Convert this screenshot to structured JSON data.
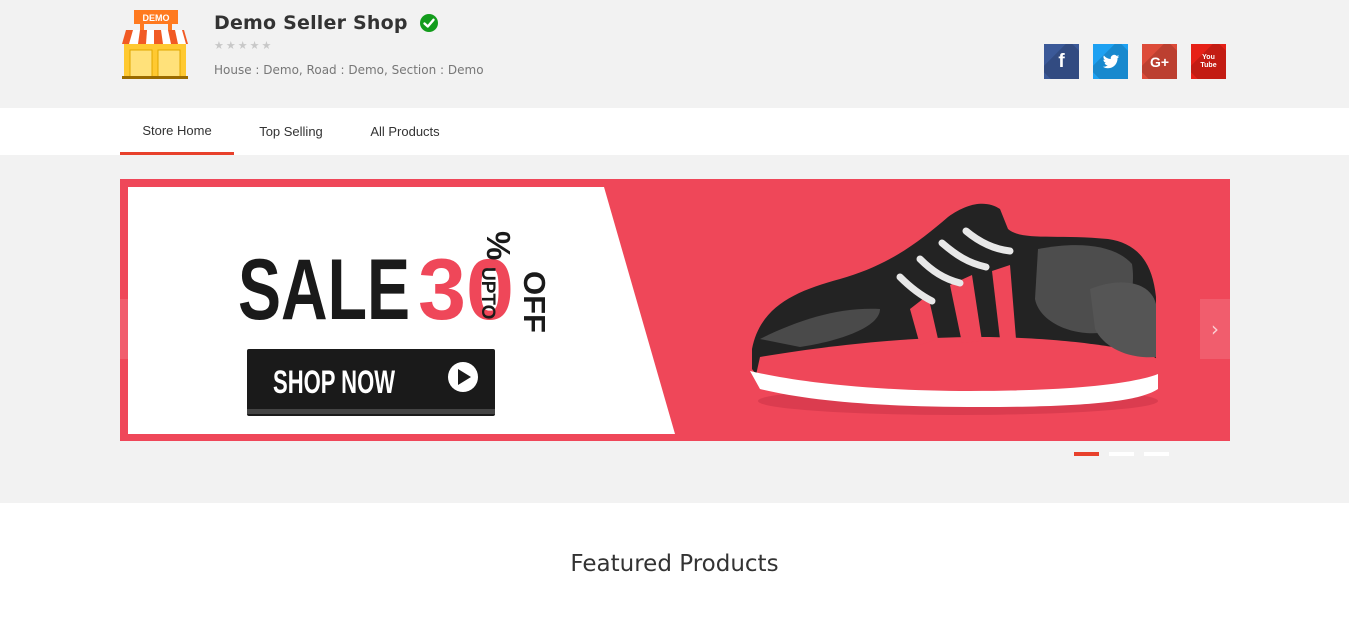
{
  "shop": {
    "logo_text": "DEMO",
    "name": "Demo Seller Shop",
    "address": "House : Demo, Road : Demo, Section : Demo",
    "rating": 0,
    "rating_max": 5
  },
  "socials": [
    {
      "icon": "facebook-icon",
      "label": "f",
      "color": "#3b5998"
    },
    {
      "icon": "twitter-icon",
      "label": "🐦",
      "color": "#1da1f2"
    },
    {
      "icon": "google-plus-icon",
      "label": "G+",
      "color": "#dd4b39"
    },
    {
      "icon": "youtube-icon",
      "label": "You Tube",
      "color": "#e62117"
    }
  ],
  "nav": {
    "tabs": [
      {
        "label": "Store Home",
        "active": true
      },
      {
        "label": "Top Selling",
        "active": false
      },
      {
        "label": "All Products",
        "active": false
      }
    ]
  },
  "banner": {
    "sale_text": "SALE",
    "discount": "30",
    "upto": "UPTO",
    "percent": "%",
    "off": "OFF",
    "button": "SHOP NOW",
    "background_color": "#ef4759",
    "slides": 3,
    "active_slide": 1
  },
  "slider": {
    "prev_icon": "chevron-left-icon",
    "next_icon": "chevron-right-icon",
    "prev": "‹",
    "next": "›"
  },
  "featured": {
    "title": "Featured Products"
  }
}
